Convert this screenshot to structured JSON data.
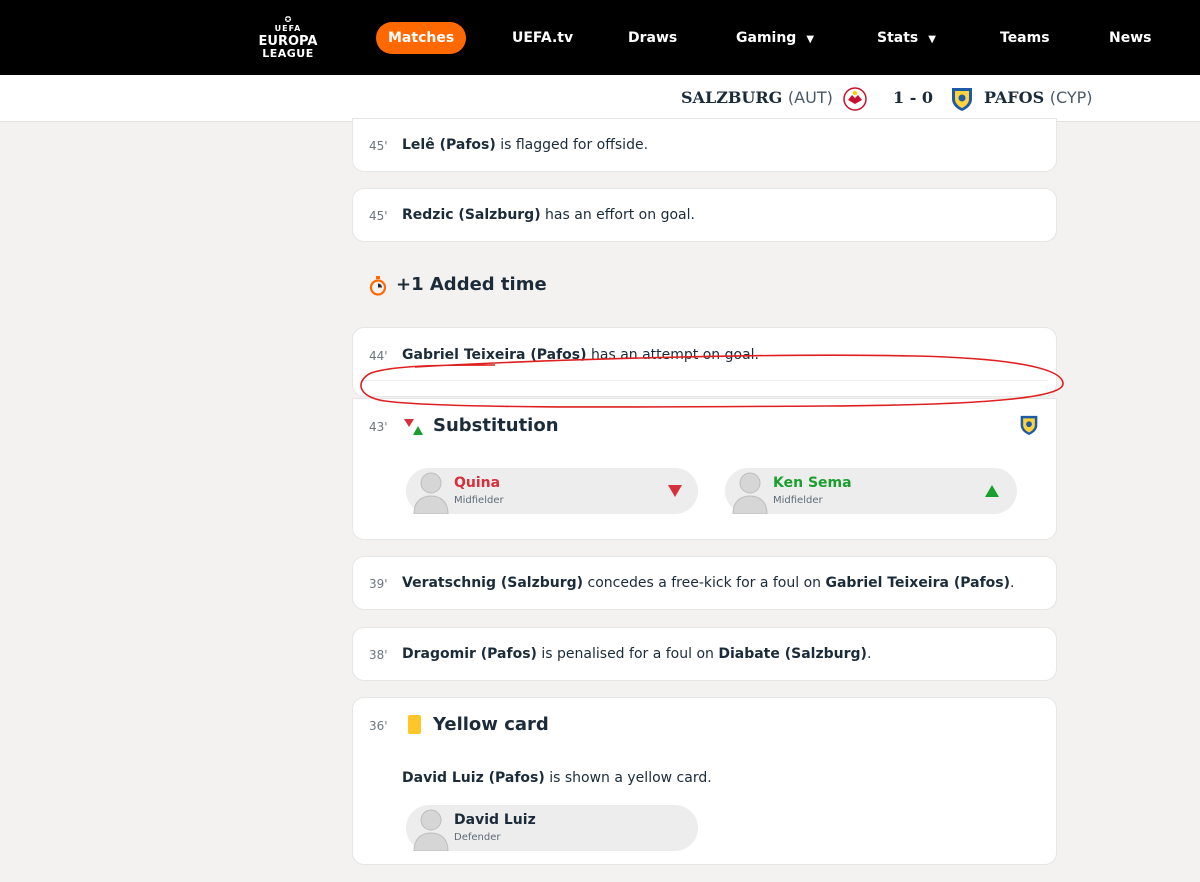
{
  "nav": {
    "logo": {
      "line1": "UEFA",
      "line2": "EUROPA",
      "line3": "LEAGUE"
    },
    "items": [
      {
        "label": "Matches",
        "active": true
      },
      {
        "label": "UEFA.tv"
      },
      {
        "label": "Draws"
      },
      {
        "label": "Gaming",
        "dropdown": true
      },
      {
        "label": "Stats",
        "dropdown": true
      },
      {
        "label": "Teams"
      },
      {
        "label": "News"
      }
    ]
  },
  "match": {
    "home": {
      "name": "SALZBURG",
      "country": "(AUT)"
    },
    "score": "1 - 0",
    "away": {
      "name": "PAFOS",
      "country": "(CYP)"
    }
  },
  "events": {
    "e1": {
      "minute": "45'",
      "player": "Lelê (Pafos)",
      "text": " is flagged for offside."
    },
    "e2": {
      "minute": "45'",
      "player": "Redzic (Salzburg)",
      "text": " has an effort on goal."
    },
    "added_time": {
      "label": "+1 Added time"
    },
    "e3": {
      "minute": "44'",
      "player": "Gabriel Teixeira (Pafos)",
      "text": " has an attempt on goal."
    },
    "sub": {
      "minute": "43'",
      "title": "Substitution",
      "out": {
        "name": "Quina",
        "role": "Midfielder"
      },
      "in": {
        "name": "Ken Sema",
        "role": "Midfielder"
      }
    },
    "e4": {
      "minute": "39'",
      "player": "Veratschnig (Salzburg)",
      "text": " concedes a free-kick for a foul on ",
      "player2": "Gabriel Teixeira (Pafos)",
      "end": "."
    },
    "e5": {
      "minute": "38'",
      "player": "Dragomir (Pafos)",
      "text": " is penalised for a foul on ",
      "player2": "Diabate (Salzburg)",
      "end": "."
    },
    "yellow": {
      "minute": "36'",
      "title": "Yellow card",
      "player": "David Luiz (Pafos)",
      "text": " is shown a yellow card.",
      "card_player": {
        "name": "David Luiz",
        "role": "Defender"
      }
    }
  },
  "colors": {
    "accent": "#ff6900",
    "sub_out": "#d6303d",
    "sub_in": "#1a9f2e",
    "yellow": "#ffc629",
    "annotation": "#e02020"
  },
  "icons": [
    "uefa-europa-league-logo",
    "salzburg-crest-icon",
    "pafos-crest-icon",
    "stopwatch-icon",
    "substitution-arrows-icon",
    "yellow-card-icon",
    "player-avatar-icon",
    "arrow-down-icon",
    "arrow-up-icon"
  ]
}
